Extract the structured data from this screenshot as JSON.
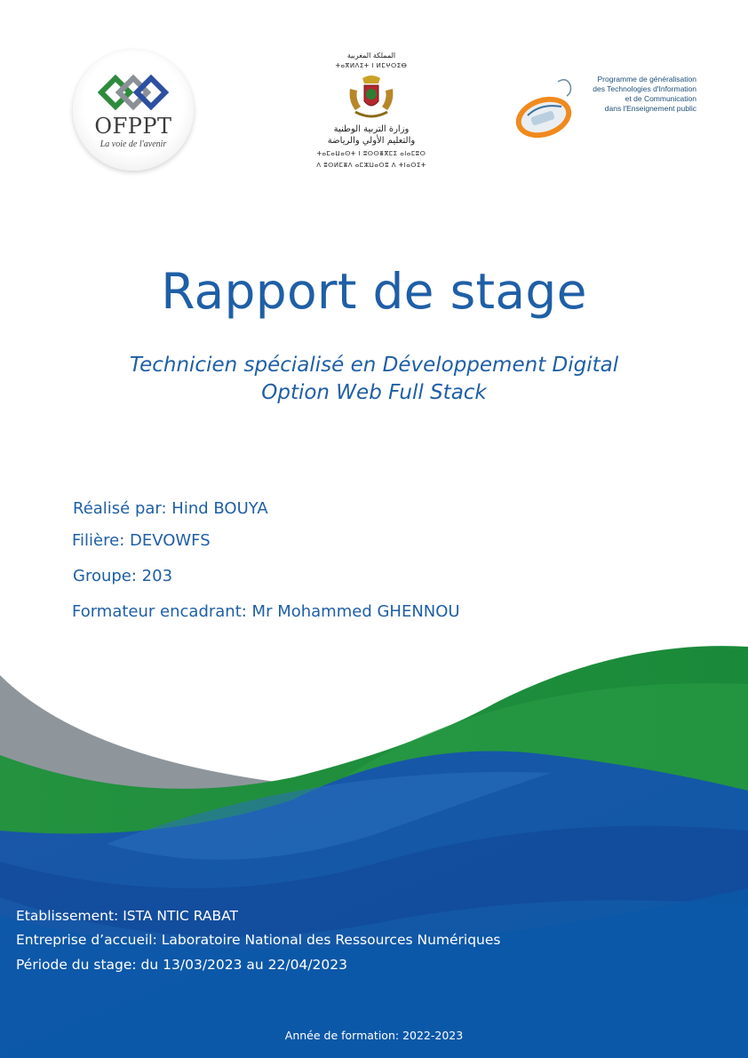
{
  "logos": {
    "ofppt_name": "OFPPT",
    "ofppt_tagline": "La voie de l'avenir",
    "ministry_arabic_top": "المملكة المغربية",
    "ministry_tifinagh_top": "ⵜⴰⴳⵍⴷⵉⵜ ⵏ ⵍⵎⵖⵔⵉⴱ",
    "ministry_arabic_line1": "وزارة التربية الوطنية",
    "ministry_arabic_line2": "والتعليم الأولي والرياضة",
    "ministry_tifinagh_line1": "ⵜⴰⵎⴰⵡⴰⵙⵜ ⵏ ⵓⵙⵙⴻⴳⵎⵉ ⴰⵏⴰⵎⵓⵔ",
    "ministry_tifinagh_line2": "ⴷ ⵓⵙⵍⵎⴻⴷ ⴰⵎⵣⵡⴰⵔⵓ ⴷ ⵜⵏⴰⵔⵉⵜ",
    "genie_line1": "Programme de généralisation",
    "genie_line2": "des Technologies d'Information",
    "genie_line3": "et de Communication",
    "genie_line4": "dans l'Enseignement public"
  },
  "title": "Rapport de stage",
  "subtitle_line1": "Technicien spécialisé en Développement Digital",
  "subtitle_line2": "Option Web Full Stack",
  "info": {
    "realise": "Réalisé par:  Hind BOUYA",
    "filiere": "Filière: DEVOWFS",
    "groupe": "Groupe: 203",
    "formateur": "Formateur encadrant: Mr Mohammed GHENNOU"
  },
  "footer": {
    "etablissement": "Etablissement:  ISTA NTIC RABAT",
    "entreprise": "Entreprise d’accueil:  Laboratoire National des Ressources Numériques",
    "periode": "Période du stage:  du 13/03/2023 au 22/04/2023",
    "annee": "Année de formation: 2022-2023"
  },
  "colors": {
    "primary_blue": "#1f5fa6",
    "wave_green": "#1f8a3c",
    "wave_gray": "#8e969c",
    "wave_blue": "#0d4fa0"
  }
}
